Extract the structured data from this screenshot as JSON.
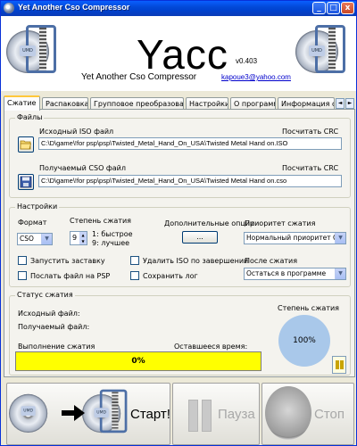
{
  "window": {
    "title": "Yet Another Cso Compressor",
    "controls": {
      "minimize": "_",
      "maximize": "□",
      "close": "x"
    }
  },
  "header": {
    "logo": "Yacc",
    "version": "v0.403",
    "subtitle": "Yet Another Cso Compressor",
    "email": "kapoue3@yahoo.com",
    "disc_label": "UMD"
  },
  "tabs": [
    "Сжатие",
    "Распаковка",
    "Групповое преобразование",
    "Настройки",
    "О программе",
    "Информация о сж"
  ],
  "tab_scroll": {
    "left": "◄",
    "right": "►"
  },
  "files": {
    "group_title": "Файлы",
    "source_label": "Исходный ISO файл",
    "source_crc": "Посчитать CRC",
    "source_path": "C:\\D\\game\\!for psp\\psp\\Twisted_Metal_Hand_On_USA\\Twisted Metal Hand on.ISO",
    "target_label": "Получаемый CSO файл",
    "target_crc": "Посчитать CRC",
    "target_path": "C:\\D\\game\\!for psp\\psp\\Twisted_Metal_Hand_On_USA\\Twisted Metal Hand on.cso"
  },
  "settings": {
    "group_title": "Настройки",
    "format_label": "Формат",
    "format_value": "CSO",
    "level_label": "Степень сжатия",
    "level_value": "9",
    "level_hint_1": "1: быстрое",
    "level_hint_2": "9: лучшее",
    "extra_label": "Дополнительные опции",
    "extra_button": "...",
    "priority_label": "Приоритет сжатия",
    "priority_value": "Нормальный приоритет CPU",
    "after_label": "После сжатия",
    "after_value": "Остаться в программе",
    "checkboxes": {
      "run_splash": "Запустить заставку",
      "send_psp": "Послать файл на PSP",
      "delete_iso": "Удалить ISO по завершении",
      "save_log": "Сохранить лог"
    }
  },
  "status": {
    "group_title": "Статус сжатия",
    "source_file_label": "Исходный файл:",
    "target_file_label": "Получаемый файл:",
    "progress_label": "Выполнение сжатия",
    "remaining_label": "Оставшееся время:",
    "progress_value": "0%",
    "ratio_label": "Степень сжатия",
    "ratio_value": "100%"
  },
  "actions": {
    "start": "Старт!",
    "pause": "Пауза",
    "stop": "Стоп"
  },
  "colors": {
    "titlebar": "#0349d8",
    "progress": "#ffff00",
    "ratio_circle": "#a9c8ea",
    "tab_accent": "#ffc83c"
  }
}
